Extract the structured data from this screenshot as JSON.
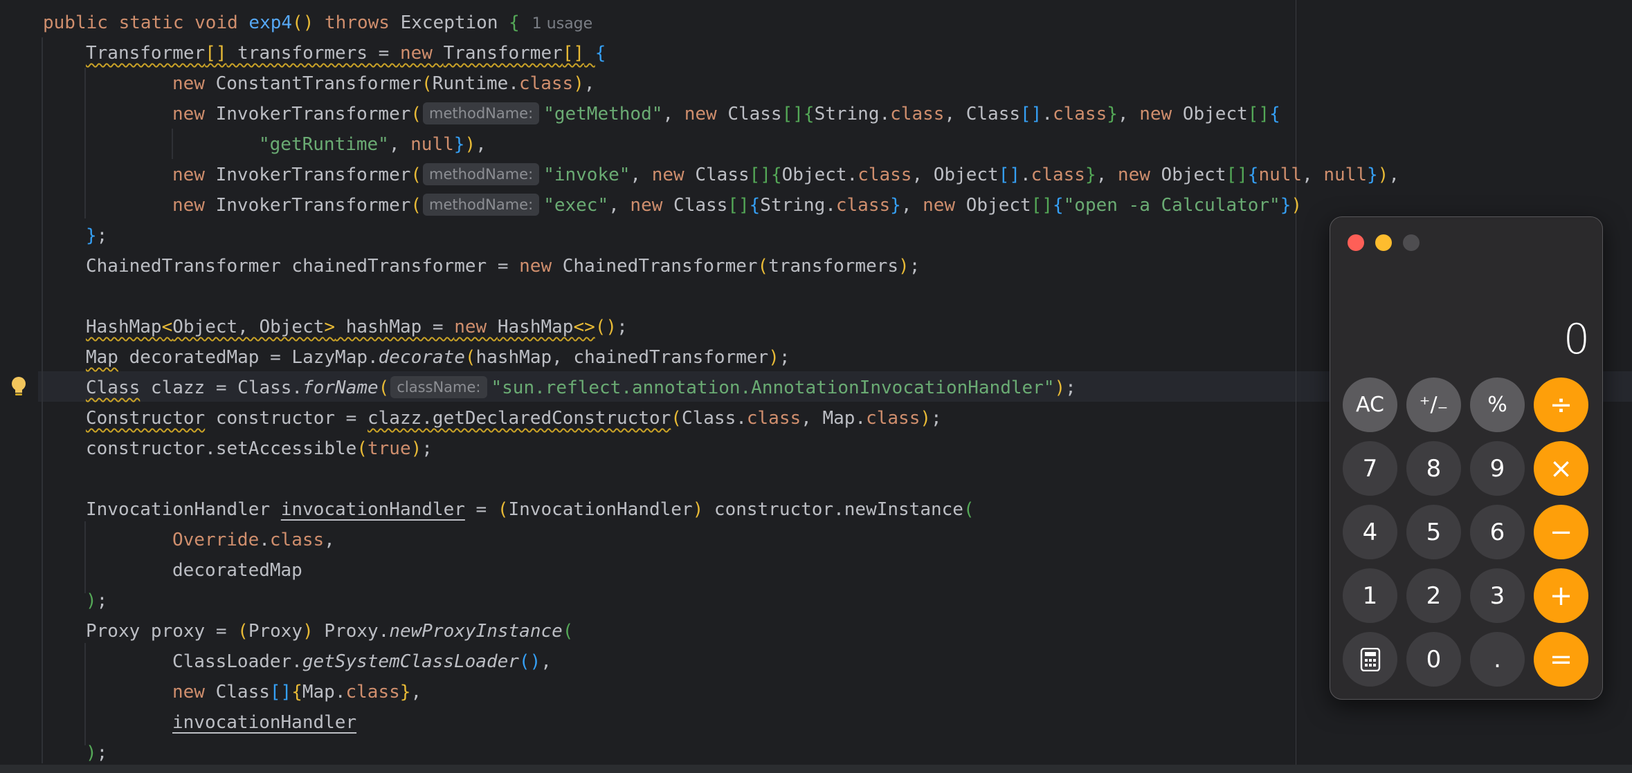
{
  "editor": {
    "usage_hint": "1 usage",
    "hints": {
      "method_name": "methodName:",
      "class_name": "className:"
    },
    "strings": {
      "get_method": "\"getMethod\"",
      "get_runtime": "\"getRuntime\"",
      "invoke": "\"invoke\"",
      "exec": "\"exec\"",
      "open_calc": "\"open -a Calculator\"",
      "handler_class": "\"sun.reflect.annotation.AnnotationInvocationHandler\""
    }
  },
  "calculator": {
    "display": "0",
    "keys": [
      {
        "label": "AC",
        "kind": "function",
        "name": "all-clear-button"
      },
      {
        "label": "⁺∕₋",
        "kind": "function",
        "name": "plus-minus-button"
      },
      {
        "label": "%",
        "kind": "function",
        "name": "percent-button"
      },
      {
        "label": "÷",
        "kind": "operator",
        "name": "divide-button"
      },
      {
        "label": "7",
        "kind": "number",
        "name": "digit-7-button"
      },
      {
        "label": "8",
        "kind": "number",
        "name": "digit-8-button"
      },
      {
        "label": "9",
        "kind": "number",
        "name": "digit-9-button"
      },
      {
        "label": "×",
        "kind": "operator",
        "name": "multiply-button"
      },
      {
        "label": "4",
        "kind": "number",
        "name": "digit-4-button"
      },
      {
        "label": "5",
        "kind": "number",
        "name": "digit-5-button"
      },
      {
        "label": "6",
        "kind": "number",
        "name": "digit-6-button"
      },
      {
        "label": "−",
        "kind": "operator",
        "name": "subtract-button"
      },
      {
        "label": "1",
        "kind": "number",
        "name": "digit-1-button"
      },
      {
        "label": "2",
        "kind": "number",
        "name": "digit-2-button"
      },
      {
        "label": "3",
        "kind": "number",
        "name": "digit-3-button"
      },
      {
        "label": "+",
        "kind": "operator",
        "name": "add-button"
      },
      {
        "label": "calculator-icon",
        "kind": "icon",
        "name": "mode-menu-button"
      },
      {
        "label": "0",
        "kind": "number",
        "name": "digit-0-button"
      },
      {
        "label": ".",
        "kind": "number",
        "name": "decimal-button"
      },
      {
        "label": "=",
        "kind": "operator",
        "name": "equals-button"
      }
    ],
    "colors": {
      "operator": "#fe9f0a",
      "function": "#5c5b5e",
      "number": "#3e3d40",
      "close": "#fe5f57",
      "minimize": "#febc2e"
    }
  }
}
